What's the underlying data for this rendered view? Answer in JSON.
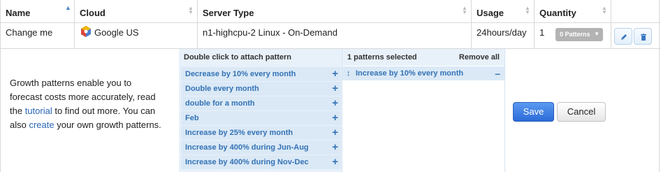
{
  "table": {
    "headers": [
      {
        "label": "Name",
        "sort": "asc"
      },
      {
        "label": "Cloud",
        "sort": "both"
      },
      {
        "label": "Server Type",
        "sort": "both"
      },
      {
        "label": "Usage",
        "sort": "both"
      },
      {
        "label": "Quantity",
        "sort": "both"
      }
    ],
    "row": {
      "name": "Change me",
      "cloud": "Google US",
      "cloud_icon": "google-cloud-logo",
      "server_type": "n1-highcpu-2 Linux - On-Demand",
      "usage": "24hours/day",
      "quantity": "1",
      "patterns_select": "0 Patterns",
      "edit_icon": "pencil-icon",
      "delete_icon": "trash-icon"
    }
  },
  "description": {
    "line1": "Growth patterns enable you to",
    "line2": "forecast costs more accurately, read",
    "line3_pre": "the ",
    "tutorial_link": "tutorial",
    "line3_post": " to find out more. You can",
    "line4_pre": "also ",
    "create_link": "create",
    "line4_post": " your own growth patterns."
  },
  "available_patterns": {
    "heading": "Double click to attach pattern",
    "add_symbol": "+",
    "items": [
      "Decrease by 10% every month",
      "Double every month",
      "double for a month",
      "Feb",
      "Increase by 25% every month",
      "Increase by 400% during Jun-Aug",
      "Increase by 400% during Nov-Dec"
    ]
  },
  "selected_patterns": {
    "heading": "1 patterns selected",
    "remove_all": "Remove all",
    "drag_symbol": "↕",
    "remove_symbol": "–",
    "items": [
      "Increase by 10% every month"
    ]
  },
  "actions": {
    "save": "Save",
    "cancel": "Cancel"
  },
  "colors": {
    "accent": "#2c6bd8",
    "pattern_text": "#3372b5",
    "panel_bg": "#e8f1fa"
  }
}
